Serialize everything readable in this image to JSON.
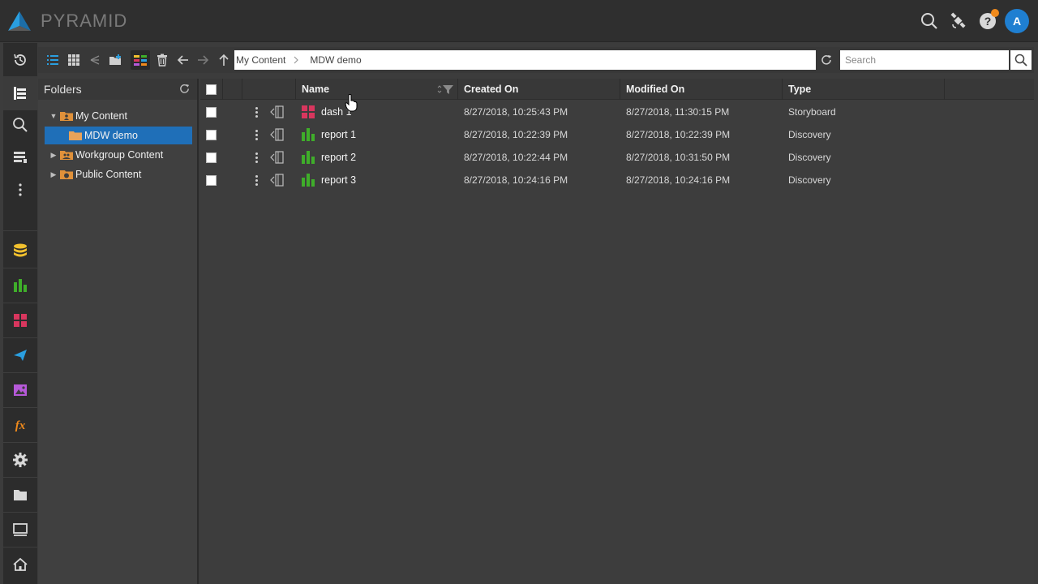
{
  "app": {
    "brand": "PYRAMID",
    "avatar_initial": "A"
  },
  "colors": {
    "accent": "#1f6fb8",
    "storyboard": "#d9365e",
    "discovery": "#3fae2a",
    "data": "#f2c12e",
    "publish": "#2a9fe0",
    "illustrate": "#b659d9",
    "formula": "#f08a1c"
  },
  "header_icons": [
    "search-icon",
    "satellite-icon",
    "help-icon"
  ],
  "rail": [
    "history-icon",
    "content-icon",
    "search-icon",
    "reports-icon",
    "more-icon",
    "database-icon",
    "discovery-icon",
    "storyboard-icon",
    "publish-icon",
    "illustrate-icon",
    "formula-icon",
    "settings-icon",
    "folder-icon",
    "presentation-icon",
    "home-icon"
  ],
  "toolbar": {
    "breadcrumb": [
      "My Content",
      "MDW demo"
    ],
    "search_placeholder": "Search"
  },
  "folders": {
    "title": "Folders",
    "items": [
      {
        "label": "My Content",
        "expanded": true
      },
      {
        "label": "MDW demo",
        "selected": true
      },
      {
        "label": "Workgroup Content",
        "expanded": false
      },
      {
        "label": "Public Content",
        "expanded": false
      }
    ]
  },
  "grid": {
    "columns": [
      "Name",
      "Created On",
      "Modified On",
      "Type"
    ],
    "rows": [
      {
        "name": "dash 1",
        "icon": "storyboard-icon",
        "created": "8/27/2018, 10:25:43 PM",
        "modified": "8/27/2018, 11:30:15 PM",
        "type": "Storyboard"
      },
      {
        "name": "report 1",
        "icon": "discovery-icon",
        "created": "8/27/2018, 10:22:39 PM",
        "modified": "8/27/2018, 10:22:39 PM",
        "type": "Discovery"
      },
      {
        "name": "report 2",
        "icon": "discovery-icon",
        "created": "8/27/2018, 10:22:44 PM",
        "modified": "8/27/2018, 10:31:50 PM",
        "type": "Discovery"
      },
      {
        "name": "report 3",
        "icon": "discovery-icon",
        "created": "8/27/2018, 10:24:16 PM",
        "modified": "8/27/2018, 10:24:16 PM",
        "type": "Discovery"
      }
    ]
  }
}
